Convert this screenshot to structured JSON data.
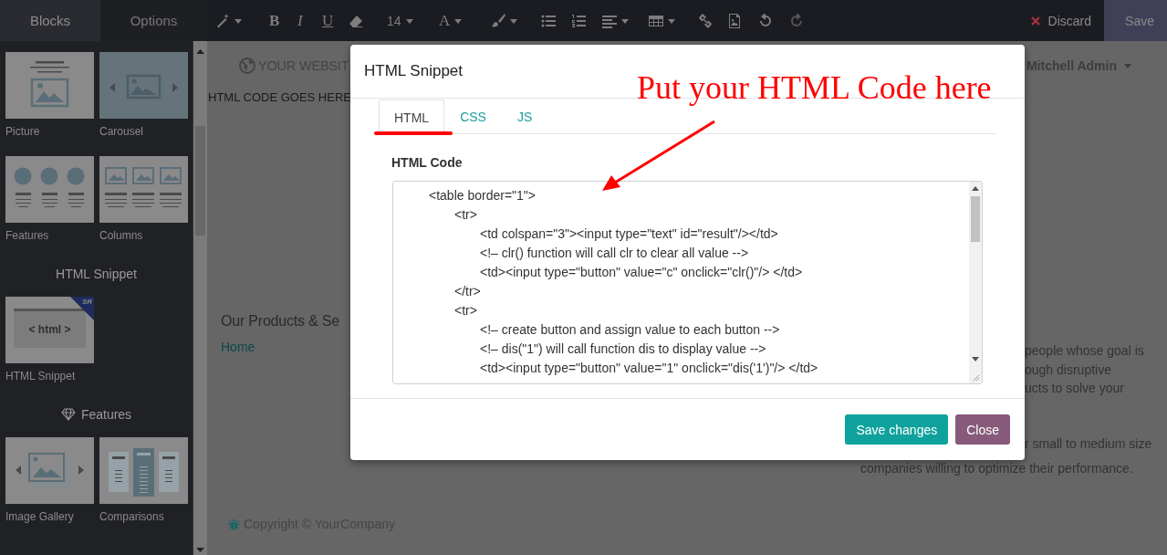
{
  "toolbar": {
    "format_buttons": [
      "B",
      "I",
      "U"
    ],
    "font_size": "14",
    "color_button": "A",
    "discard": "Discard",
    "save": "Save"
  },
  "sidebar": {
    "tabs": [
      {
        "label": "Blocks",
        "selected": true
      },
      {
        "label": "Options",
        "selected": false
      }
    ],
    "sections": [
      {
        "kind": "plain",
        "blocks": [
          {
            "label": "Picture",
            "kind": "picture"
          },
          {
            "label": "Carousel",
            "kind": "carousel"
          },
          {
            "label": "Features",
            "kind": "features"
          },
          {
            "label": "Columns",
            "kind": "columns"
          }
        ]
      },
      {
        "kind": "titled",
        "title": "HTML Snippet",
        "blocks": [
          {
            "label": "HTML Snippet",
            "kind": "html",
            "thumb_text": "< html >",
            "badge": "SR"
          }
        ]
      },
      {
        "kind": "category",
        "title": "Features",
        "blocks": [
          {
            "label": "Image Gallery",
            "kind": "gallery"
          },
          {
            "label": "Comparisons",
            "kind": "comparisons"
          }
        ]
      }
    ]
  },
  "page": {
    "brand": "YOUR WEBSIT",
    "placeholder_text": "HTML CODE GOES HERE",
    "user": "Mitchell Admin",
    "heading": "Our Products & Se",
    "link": "Home",
    "paragraphs": [
      [
        "people whose goal is",
        "ough disruptive",
        "ucts to solve your"
      ],
      [
        "r small to medium size"
      ]
    ],
    "last_line": "companies willing to optimize their performance.",
    "copyright": "Copyright © YourCompany"
  },
  "dialog": {
    "title": "HTML Snippet",
    "tabs": [
      {
        "label": "HTML",
        "selected": true
      },
      {
        "label": "CSS",
        "selected": false
      },
      {
        "label": "JS",
        "selected": false
      }
    ],
    "field_label": "HTML Code",
    "code_lines": [
      "\t<table border=\"1\">",
      "\t\t<tr>",
      "\t\t\t<td colspan=\"3\"><input type=\"text\" id=\"result\"/></td>",
      "\t\t\t<!– clr() function will call clr to clear all value -->",
      "\t\t\t<td><input type=\"button\" value=\"c\" onclick=\"clr()\"/> </td>",
      "\t\t</tr>",
      "\t\t<tr>",
      "\t\t\t<!– create button and assign value to each button -->",
      "\t\t\t<!– dis(\"1\") will call function dis to display value -->",
      "\t\t\t<td><input type=\"button\" value=\"1\" onclick=\"dis('1')\"/> </td>"
    ],
    "buttons": [
      {
        "label": "Save changes",
        "kind": "primary"
      },
      {
        "label": "Close",
        "kind": "secondary"
      }
    ]
  },
  "annotation": {
    "text": "Put your HTML Code here"
  }
}
